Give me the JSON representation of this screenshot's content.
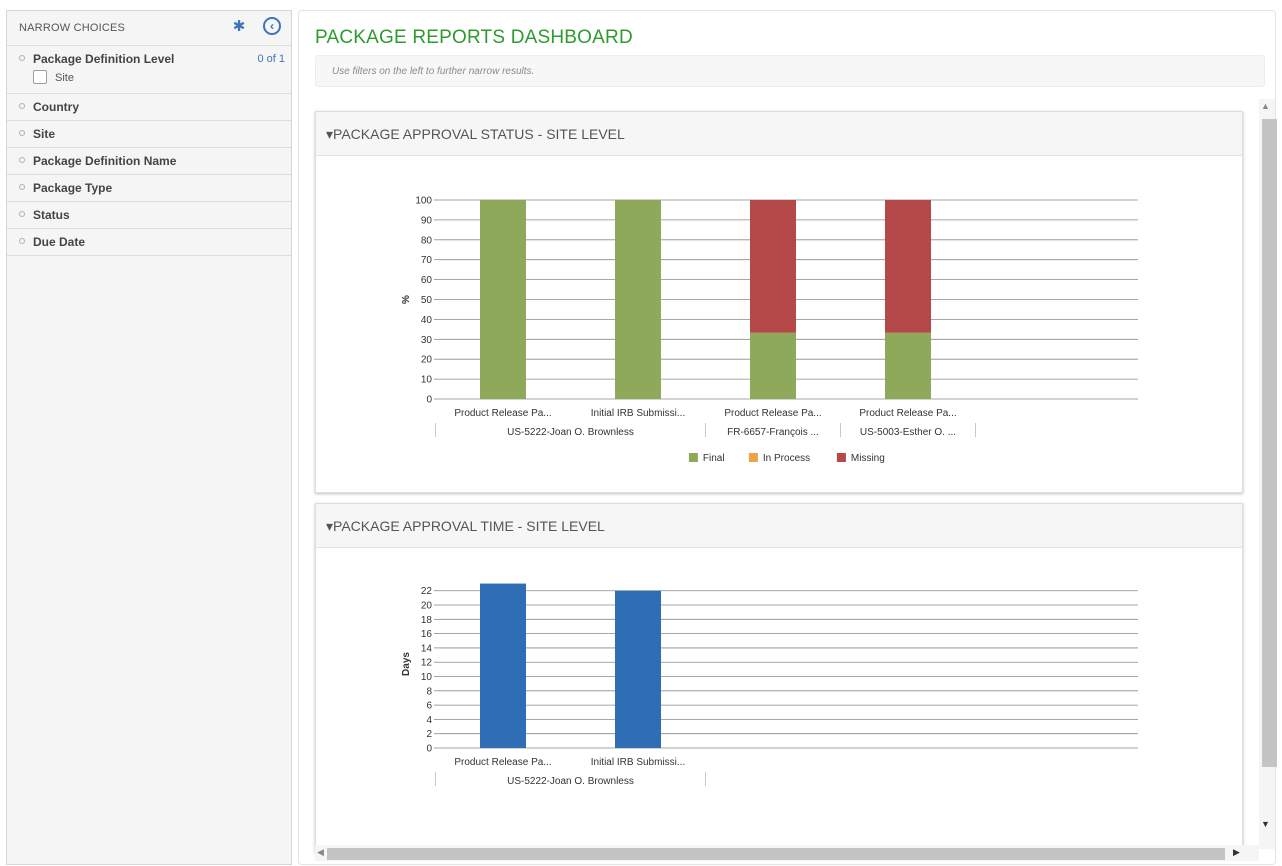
{
  "sidebar": {
    "title": "NARROW CHOICES",
    "gear_icon": "gear-icon",
    "collapse_icon": "chevron-left-circle-icon",
    "facets": [
      {
        "label": "Package Definition Level",
        "count": "0 of 1",
        "options": [
          {
            "label": "Site",
            "checked": false
          }
        ]
      },
      {
        "label": "Country"
      },
      {
        "label": "Site"
      },
      {
        "label": "Package Definition Name"
      },
      {
        "label": "Package Type"
      },
      {
        "label": "Status"
      },
      {
        "label": "Due Date"
      }
    ]
  },
  "main": {
    "title": "PACKAGE REPORTS DASHBOARD",
    "hint": "Use filters on the left to further narrow results."
  },
  "colors": {
    "title_green": "#2e9b2e",
    "final": "#8fa95a",
    "in_process": "#f0a243",
    "missing": "#b5494a",
    "days_bar": "#2f6db5",
    "accent_blue": "#3f74b8"
  },
  "chart_data": [
    {
      "type": "bar",
      "stacked": true,
      "title": "PACKAGE APPROVAL STATUS - SITE LEVEL",
      "ylabel": "%",
      "ylim": [
        0,
        100
      ],
      "yticks": [
        0,
        10,
        20,
        30,
        40,
        50,
        60,
        70,
        80,
        90,
        100
      ],
      "categories": [
        "Product Release Pa...",
        "Initial IRB Submissi...",
        "Product Release Pa...",
        "Product Release Pa..."
      ],
      "groups": [
        {
          "label": "US-5222-Joan O. Brownless",
          "span": 2
        },
        {
          "label": "FR-6657-François ...",
          "span": 1
        },
        {
          "label": "US-5003-Esther O. ...",
          "span": 1
        }
      ],
      "series": [
        {
          "name": "Final",
          "color": "#8fa95a",
          "values": [
            100,
            100,
            33.3,
            33.3
          ]
        },
        {
          "name": "In Process",
          "color": "#f0a243",
          "values": [
            0,
            0,
            0,
            0
          ]
        },
        {
          "name": "Missing",
          "color": "#b5494a",
          "values": [
            0,
            0,
            66.7,
            66.7
          ]
        }
      ],
      "legend": "bottom"
    },
    {
      "type": "bar",
      "stacked": false,
      "title": "PACKAGE APPROVAL TIME - SITE LEVEL",
      "ylabel": "Days",
      "ylim": [
        0,
        23.5
      ],
      "yticks": [
        0,
        2,
        4,
        6,
        8,
        10,
        12,
        14,
        16,
        18,
        20,
        22
      ],
      "categories": [
        "Product Release Pa...",
        "Initial IRB Submissi..."
      ],
      "groups": [
        {
          "label": "US-5222-Joan O. Brownless",
          "span": 2
        }
      ],
      "series": [
        {
          "color": "#2f6db5",
          "values": [
            23,
            22
          ]
        }
      ]
    }
  ]
}
